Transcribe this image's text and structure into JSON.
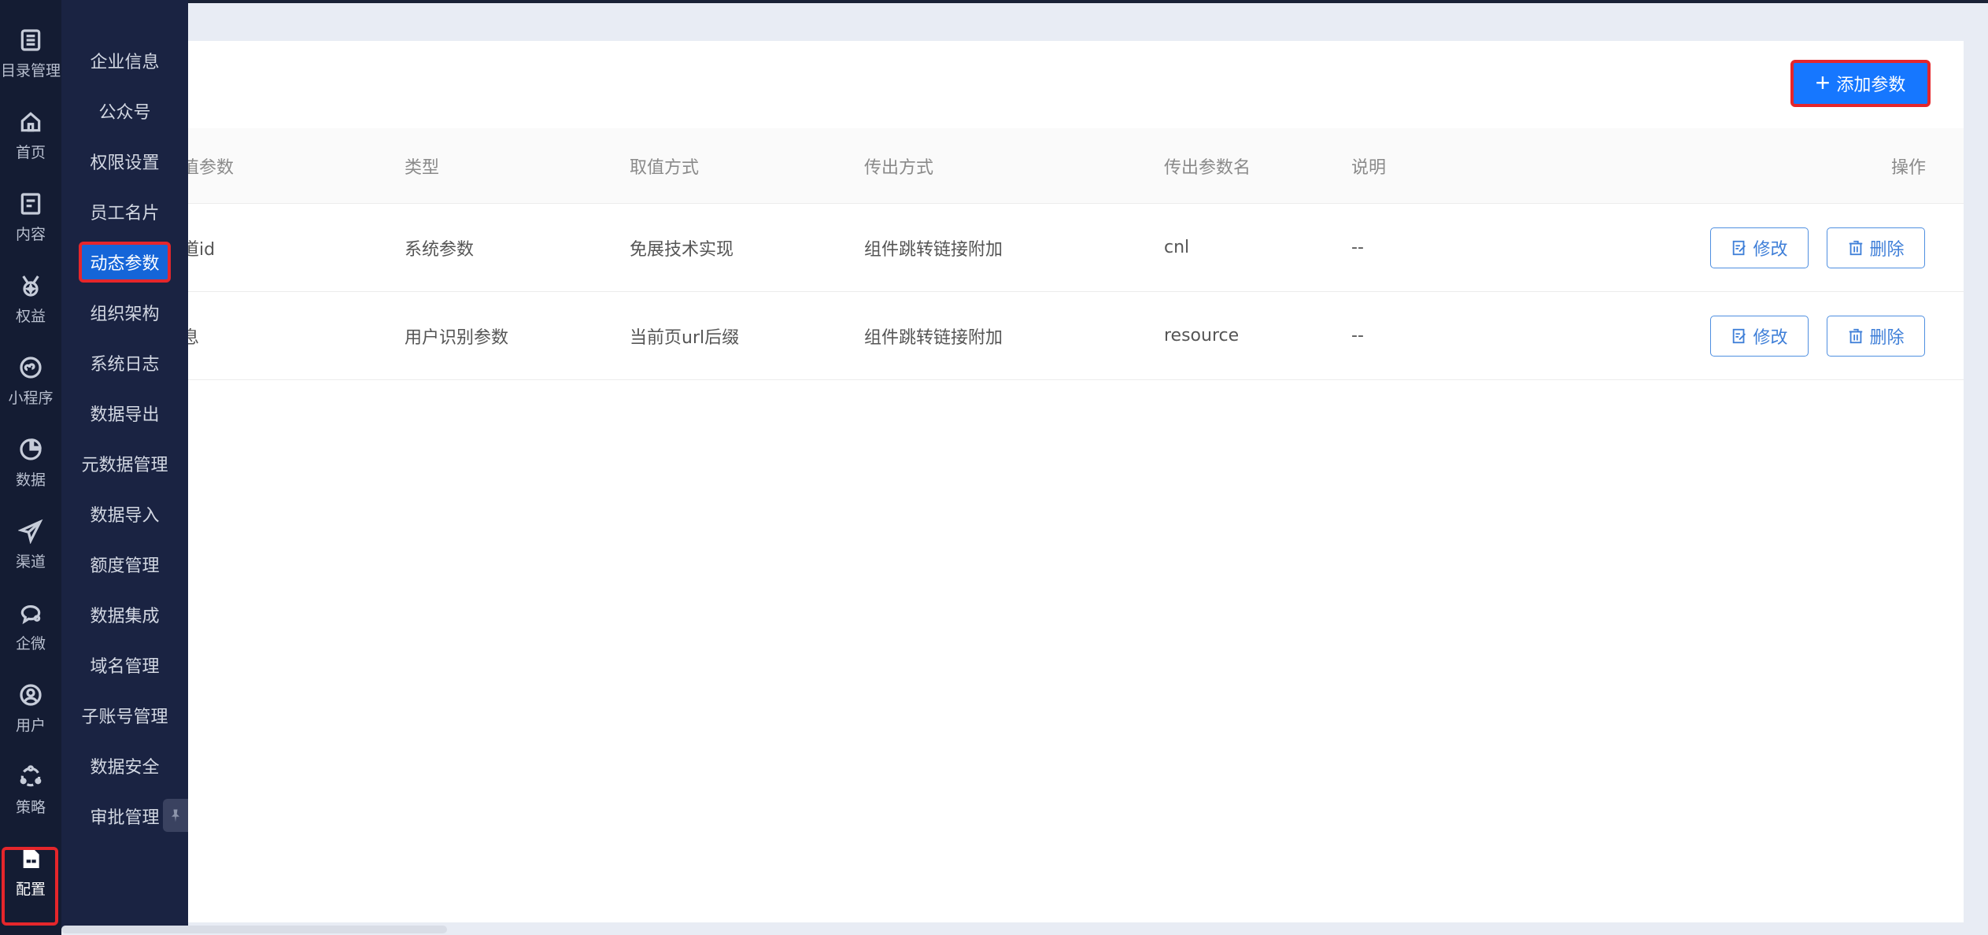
{
  "rail": {
    "items": [
      {
        "label": "目录管理",
        "icon": "list-icon"
      },
      {
        "label": "首页",
        "icon": "home-icon"
      },
      {
        "label": "内容",
        "icon": "document-icon"
      },
      {
        "label": "权益",
        "icon": "medal-icon"
      },
      {
        "label": "小程序",
        "icon": "mini-program-icon"
      },
      {
        "label": "数据",
        "icon": "pie-chart-icon"
      },
      {
        "label": "渠道",
        "icon": "send-icon"
      },
      {
        "label": "企微",
        "icon": "chat-icon"
      },
      {
        "label": "用户",
        "icon": "user-icon"
      },
      {
        "label": "策略",
        "icon": "strategy-icon"
      },
      {
        "label": "配置",
        "icon": "config-icon"
      }
    ],
    "active": "配置"
  },
  "submenu": {
    "items": [
      "企业信息",
      "公众号",
      "权限设置",
      "员工名片",
      "动态参数",
      "组织架构",
      "系统日志",
      "数据导出",
      "元数据管理",
      "数据导入",
      "额度管理",
      "数据集成",
      "域名管理",
      "子账号管理",
      "数据安全",
      "审批管理"
    ],
    "active": "动态参数"
  },
  "toolbar": {
    "add_label": "添加参数"
  },
  "table": {
    "headers": [
      "值参数",
      "类型",
      "取值方式",
      "传出方式",
      "传出参数名",
      "说明",
      "操作"
    ],
    "rows": [
      {
        "param": "道id",
        "type": "系统参数",
        "method": "免展技术实现",
        "output": "组件跳转链接附加",
        "out_name": "cnl",
        "desc": "--"
      },
      {
        "param": "息",
        "type": "用户识别参数",
        "method": "当前页url后缀",
        "output": "组件跳转链接附加",
        "out_name": "resource",
        "desc": "--"
      }
    ],
    "edit_label": "修改",
    "delete_label": "删除"
  },
  "colors": {
    "rail_bg": "#141c33",
    "submenu_bg": "#1a2342",
    "primary": "#1677ff",
    "highlight": "#e5262b"
  }
}
